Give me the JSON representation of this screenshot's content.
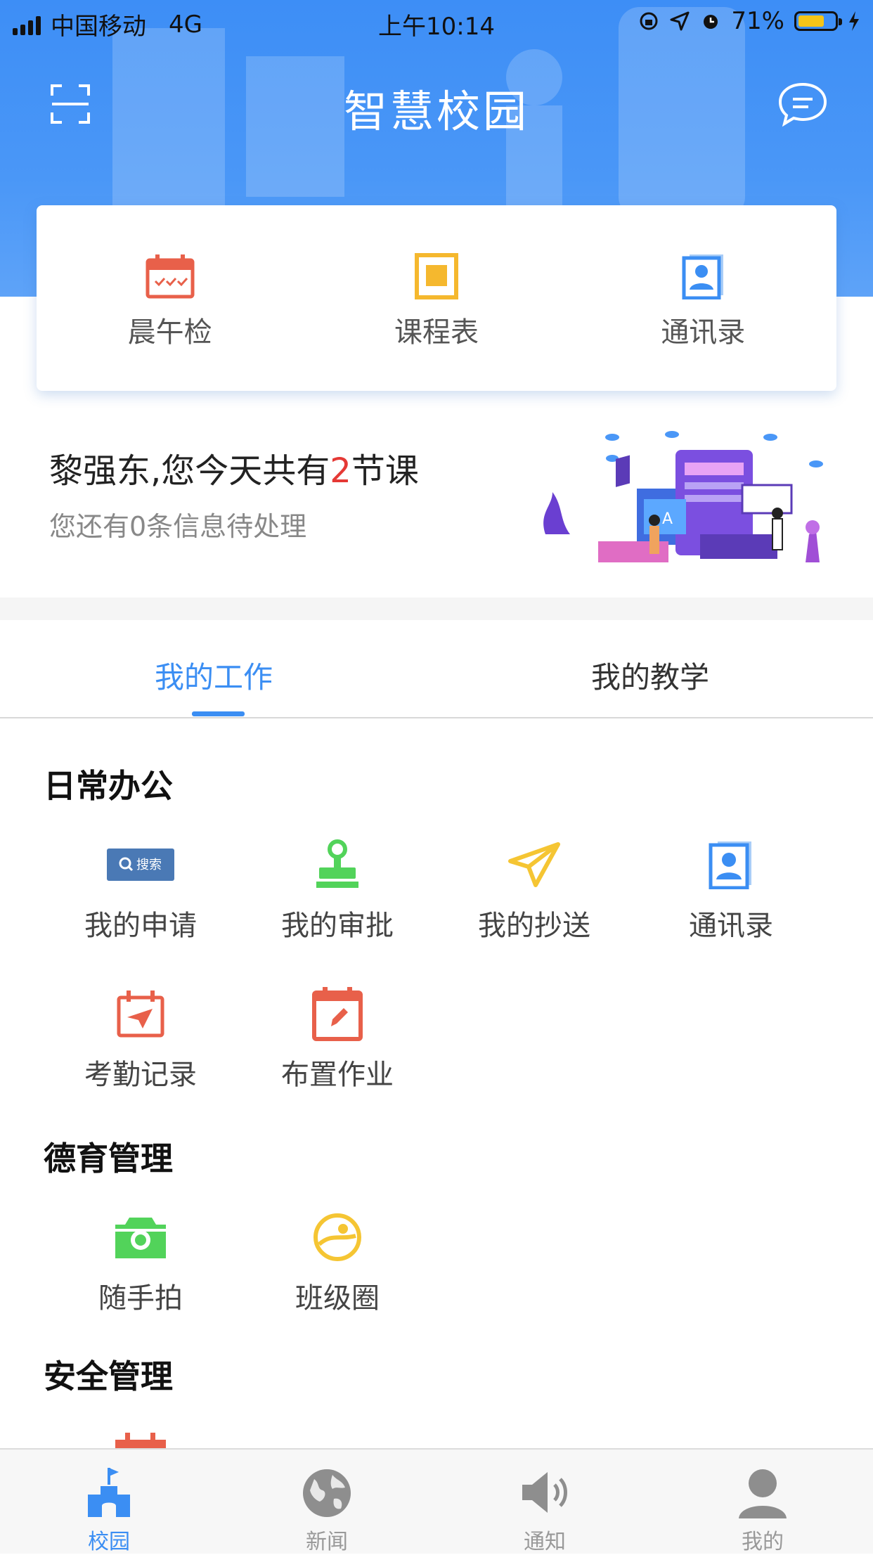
{
  "status_bar": {
    "carrier": "中国移动",
    "network": "4G",
    "time": "上午10:14",
    "battery": "71%",
    "battery_level": 0.71
  },
  "header": {
    "title": "智慧校园",
    "scan_icon": "scan-icon",
    "message_icon": "chat-bubble-icon"
  },
  "quick_actions": [
    {
      "label": "晨午检",
      "icon": "calendar-check-icon",
      "color": "#e8604a"
    },
    {
      "label": "课程表",
      "icon": "schedule-icon",
      "color": "#f5b82e"
    },
    {
      "label": "通讯录",
      "icon": "contacts-icon",
      "color": "#3b8ef3"
    }
  ],
  "greeting": {
    "prefix": "黎强东,您今天共有",
    "count": "2",
    "suffix": "节课",
    "pending": "您还有0条信息待处理"
  },
  "tabs": [
    {
      "label": "我的工作",
      "active": true
    },
    {
      "label": "我的教学",
      "active": false
    }
  ],
  "sections": [
    {
      "title": "日常办公",
      "items": [
        {
          "label": "我的申请",
          "icon": "search-badge-icon"
        },
        {
          "label": "我的审批",
          "icon": "stamp-icon"
        },
        {
          "label": "我的抄送",
          "icon": "paper-plane-icon"
        },
        {
          "label": "通讯录",
          "icon": "contacts-icon"
        },
        {
          "label": "考勤记录",
          "icon": "attendance-calendar-icon"
        },
        {
          "label": "布置作业",
          "icon": "homework-calendar-icon"
        }
      ]
    },
    {
      "title": "德育管理",
      "items": [
        {
          "label": "随手拍",
          "icon": "camera-icon"
        },
        {
          "label": "班级圈",
          "icon": "class-circle-icon"
        }
      ]
    },
    {
      "title": "安全管理",
      "items": []
    }
  ],
  "tabbar": [
    {
      "label": "校园",
      "icon": "campus-icon",
      "active": true
    },
    {
      "label": "新闻",
      "icon": "globe-icon",
      "active": false
    },
    {
      "label": "通知",
      "icon": "speaker-icon",
      "active": false
    },
    {
      "label": "我的",
      "icon": "person-icon",
      "active": false
    }
  ],
  "colors": {
    "primary": "#3b8ef3",
    "header_bg": "#4a97f7",
    "highlight": "#e53935",
    "red_icon": "#e8604a",
    "green_icon": "#52d35a",
    "yellow_icon": "#f5c533"
  }
}
